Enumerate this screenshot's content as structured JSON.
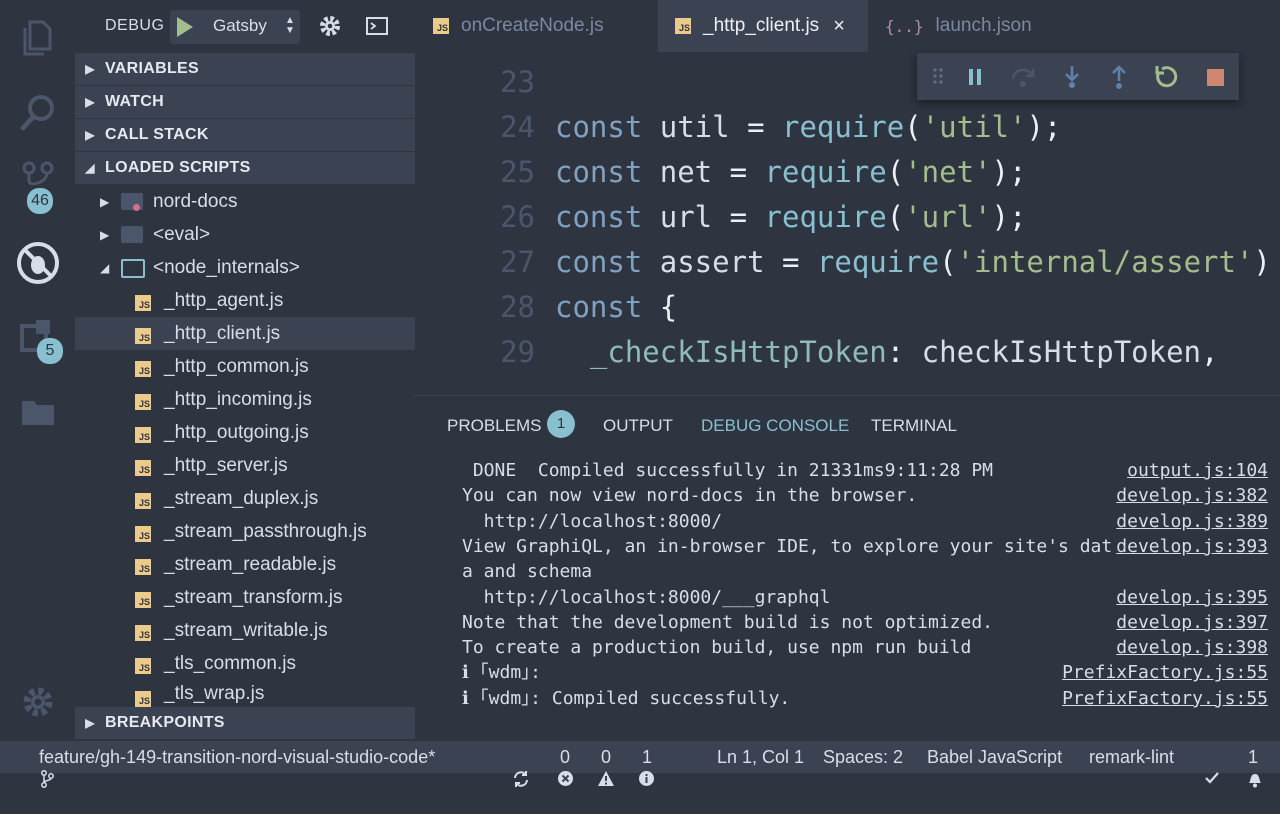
{
  "activity_bar": {
    "scm_badge": "46",
    "extensions_badge": "5"
  },
  "debug_toolbar": {
    "label": "DEBUG",
    "config": "Gatsby"
  },
  "sections": {
    "variables": "VARIABLES",
    "watch": "WATCH",
    "call_stack": "CALL STACK",
    "loaded_scripts": "LOADED SCRIPTS",
    "breakpoints": "BREAKPOINTS"
  },
  "tree": {
    "folders": [
      "nord-docs",
      "<eval>",
      "<node_internals>"
    ],
    "files": [
      "_http_agent.js",
      "_http_client.js",
      "_http_common.js",
      "_http_incoming.js",
      "_http_outgoing.js",
      "_http_server.js",
      "_stream_duplex.js",
      "_stream_passthrough.js",
      "_stream_readable.js",
      "_stream_transform.js",
      "_stream_writable.js",
      "_tls_common.js",
      "_tls_wrap.js"
    ],
    "js_icon_text": "JS"
  },
  "tabs": [
    {
      "label": "onCreateNode.js",
      "icon": "js-icon"
    },
    {
      "label": "_http_client.js",
      "icon": "js-icon",
      "close": "×"
    },
    {
      "label": "launch.json",
      "icon": "json-icon",
      "icon_text": "{..}"
    }
  ],
  "editor": {
    "lines": [
      {
        "num": "23",
        "tokens": []
      },
      {
        "num": "24",
        "tokens": [
          [
            "kw",
            "const "
          ],
          [
            "id",
            "util "
          ],
          [
            "pun",
            "= "
          ],
          [
            "fn",
            "require"
          ],
          [
            "pun",
            "("
          ],
          [
            "str",
            "'util'"
          ],
          [
            "pun",
            ");"
          ]
        ]
      },
      {
        "num": "25",
        "tokens": [
          [
            "kw",
            "const "
          ],
          [
            "id",
            "net "
          ],
          [
            "pun",
            "= "
          ],
          [
            "fn",
            "require"
          ],
          [
            "pun",
            "("
          ],
          [
            "str",
            "'net'"
          ],
          [
            "pun",
            ");"
          ]
        ]
      },
      {
        "num": "26",
        "tokens": [
          [
            "kw",
            "const "
          ],
          [
            "id",
            "url "
          ],
          [
            "pun",
            "= "
          ],
          [
            "fn",
            "require"
          ],
          [
            "pun",
            "("
          ],
          [
            "str",
            "'url'"
          ],
          [
            "pun",
            ");"
          ]
        ]
      },
      {
        "num": "27",
        "tokens": [
          [
            "kw",
            "const "
          ],
          [
            "id",
            "assert "
          ],
          [
            "pun",
            "= "
          ],
          [
            "fn",
            "require"
          ],
          [
            "pun",
            "("
          ],
          [
            "str",
            "'internal/assert'"
          ],
          [
            "pun",
            ")"
          ]
        ]
      },
      {
        "num": "28",
        "tokens": [
          [
            "kw",
            "const "
          ],
          [
            "pun",
            "{"
          ]
        ]
      },
      {
        "num": "29",
        "tokens": [
          [
            "id",
            "  "
          ],
          [
            "prop",
            "_checkIsHttpToken"
          ],
          [
            "pun",
            ": "
          ],
          [
            "id",
            "checkIsHttpToken"
          ],
          [
            "pun",
            ","
          ]
        ]
      }
    ]
  },
  "panel": {
    "tabs": {
      "problems": "PROBLEMS",
      "output": "OUTPUT",
      "debug_console": "DEBUG CONSOLE",
      "terminal": "TERMINAL"
    },
    "problems_count": "1",
    "console": [
      {
        "text": " DONE  Compiled successfully in 21331ms9:11:28 PM",
        "src": "output.js:104"
      },
      {
        "text": "You can now view nord-docs in the browser.",
        "src": "develop.js:382"
      },
      {
        "text": "  http://localhost:8000/",
        "src": "develop.js:389"
      },
      {
        "text": "View GraphiQL, an in-browser IDE, to explore your site's dat",
        "src": "develop.js:393"
      },
      {
        "text": "a and schema",
        "src": ""
      },
      {
        "text": "  http://localhost:8000/___graphql",
        "src": "develop.js:395"
      },
      {
        "text": "Note that the development build is not optimized.",
        "src": "develop.js:397"
      },
      {
        "text": "To create a production build, use npm run build",
        "src": "develop.js:398"
      },
      {
        "text": "ℹ ｢wdm｣:",
        "src": "PrefixFactory.js:55"
      },
      {
        "text": "ℹ ｢wdm｣: Compiled successfully.",
        "src": "PrefixFactory.js:55"
      }
    ]
  },
  "status_bar": {
    "branch": "feature/gh-149-transition-nord-visual-studio-code*",
    "errors": "0",
    "warnings": "0",
    "infos": "1",
    "position": "Ln 1, Col 1",
    "spaces": "Spaces: 2",
    "language": "Babel JavaScript",
    "linter": "remark-lint",
    "notifications": "1"
  },
  "colors": {
    "background": "#2e3440",
    "surface": "#3b4252",
    "accent": "#88c0d0",
    "string": "#a3be8c",
    "keyword": "#81a1c1",
    "js_icon": "#ebcb8b",
    "stop": "#bf616a"
  }
}
